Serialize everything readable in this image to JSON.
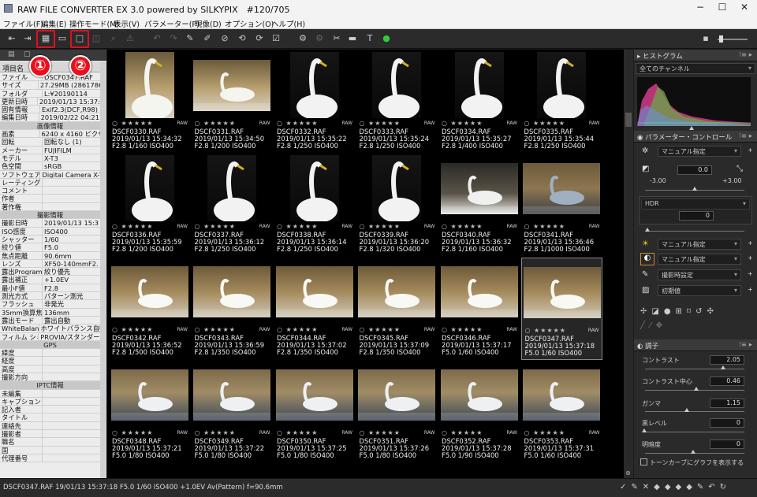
{
  "window": {
    "title": "RAW FILE CONVERTER EX 3.0 powered by SILKYPIX　#120/705"
  },
  "menu": [
    "ファイル(F)",
    "編集(E)",
    "操作モード(M)",
    "表示(V)",
    "パラメーター(P)",
    "現像(D)",
    "オプション(O)",
    "ヘルプ(H)"
  ],
  "markers": [
    "①",
    "②"
  ],
  "exif_header": "項目名",
  "exif_rows": [
    {
      "k": "ファイル",
      "v": "DSCF0347.RAF"
    },
    {
      "k": "サイズ",
      "v": "27.29MB (28617867"
    },
    {
      "k": "フォルダ",
      "v": "L:¥20190114"
    },
    {
      "k": "更新日時",
      "v": "2019/01/13 15:37:18"
    },
    {
      "k": "固有情報",
      "v": "Exif2.3(DCF,R98) Y"
    },
    {
      "k": "編集日時",
      "v": "2019/02/22 04:21:5"
    },
    {
      "section": "画像情報"
    },
    {
      "k": "画素",
      "v": "6240 x 4160 ピクセ"
    },
    {
      "k": "回転",
      "v": "回転なし (1)"
    },
    {
      "k": "メーカー",
      "v": "FUJIFILM"
    },
    {
      "k": "モデル",
      "v": "X-T3"
    },
    {
      "k": "色空間",
      "v": "sRGB"
    },
    {
      "k": "ソフトウェア",
      "v": "Digital Camera X-T"
    },
    {
      "k": "レーティング",
      "v": ""
    },
    {
      "k": "コメント",
      "v": ""
    },
    {
      "k": "作者",
      "v": ""
    },
    {
      "k": "著作権",
      "v": ""
    },
    {
      "section": "撮影情報"
    },
    {
      "k": "撮影日時",
      "v": "2019/01/13 15:3"
    },
    {
      "k": "ISO感度",
      "v": "ISO400"
    },
    {
      "k": "シャッター",
      "v": "1/60"
    },
    {
      "k": "絞り値",
      "v": "F5.0"
    },
    {
      "k": "焦点距離",
      "v": "90.6mm"
    },
    {
      "k": "レンズ",
      "v": "XF50-140mmF2."
    },
    {
      "k": "露出Program",
      "v": "絞り優先"
    },
    {
      "k": "露出補正",
      "v": "+1.0EV"
    },
    {
      "k": "最小F値",
      "v": "F2.8"
    },
    {
      "k": "測光方式",
      "v": "パターン測光"
    },
    {
      "k": "フラッシュ",
      "v": "非発光"
    },
    {
      "k": "35mm換算焦",
      "v": "136mm"
    },
    {
      "k": "露出モード",
      "v": "露出自動"
    },
    {
      "k": "WhiteBalance",
      "v": "ホワイトバランス自動"
    },
    {
      "k": "フィルム シミュレ",
      "v": "PROVIA/スタンダード"
    },
    {
      "section": "GPS"
    },
    {
      "k": "緯度",
      "v": ""
    },
    {
      "k": "経度",
      "v": ""
    },
    {
      "k": "高度",
      "v": ""
    },
    {
      "k": "撮影方向",
      "v": ""
    },
    {
      "section": "IPTC情報"
    },
    {
      "k": "未編集",
      "v": ""
    },
    {
      "k": "キャプション",
      "v": ""
    },
    {
      "k": "記入者",
      "v": ""
    },
    {
      "k": "タイトル",
      "v": ""
    },
    {
      "k": "連絡先",
      "v": ""
    },
    {
      "k": "撮影者",
      "v": ""
    },
    {
      "k": "職名",
      "v": ""
    },
    {
      "k": "国",
      "v": ""
    },
    {
      "k": "代理番号",
      "v": ""
    }
  ],
  "thumbs": [
    {
      "name": "DSCF0330.RAF",
      "date": "2019/01/13 15:34:32",
      "exp": "F2.8 1/160 ISO400",
      "orient": "p",
      "scene": "a"
    },
    {
      "name": "DSCF0331.RAF",
      "date": "2019/01/13 15:34:50",
      "exp": "F2.8 1/200 ISO400",
      "orient": "l",
      "scene": "a"
    },
    {
      "name": "DSCF0332.RAF",
      "date": "2019/01/13 15:35:22",
      "exp": "F2.8 1/250 ISO400",
      "orient": "p",
      "scene": "b"
    },
    {
      "name": "DSCF0333.RAF",
      "date": "2019/01/13 15:35:24",
      "exp": "F2.8 1/250 ISO400",
      "orient": "p",
      "scene": "b"
    },
    {
      "name": "DSCF0334.RAF",
      "date": "2019/01/13 15:35:27",
      "exp": "F2.8 1/400 ISO400",
      "orient": "p",
      "scene": "b"
    },
    {
      "name": "DSCF0335.RAF",
      "date": "2019/01/13 15:35:44",
      "exp": "F2.8 1/250 ISO400",
      "orient": "p",
      "scene": "b"
    },
    {
      "name": "DSCF0336.RAF",
      "date": "2019/01/13 15:35:59",
      "exp": "F2.8 1/200 ISO400",
      "orient": "p",
      "scene": "b"
    },
    {
      "name": "DSCF0337.RAF",
      "date": "2019/01/13 15:36:12",
      "exp": "F2.8 1/250 ISO400",
      "orient": "p",
      "scene": "b"
    },
    {
      "name": "DSCF0338.RAF",
      "date": "2019/01/13 15:36:14",
      "exp": "F2.8 1/250 ISO400",
      "orient": "p",
      "scene": "b"
    },
    {
      "name": "DSCF0339.RAF",
      "date": "2019/01/13 15:36:20",
      "exp": "F2.8 1/320 ISO400",
      "orient": "p",
      "scene": "b"
    },
    {
      "name": "DSCF0340.RAF",
      "date": "2019/01/13 15:36:32",
      "exp": "F2.8 1/160 ISO400",
      "orient": "l",
      "scene": "c"
    },
    {
      "name": "DSCF0341.RAF",
      "date": "2019/01/13 15:36:46",
      "exp": "F2.8 1/1000 ISO400",
      "orient": "l",
      "scene": "d"
    },
    {
      "name": "DSCF0342.RAF",
      "date": "2019/01/13 15:36:52",
      "exp": "F2.8 1/500 ISO400",
      "orient": "l",
      "scene": "e"
    },
    {
      "name": "DSCF0343.RAF",
      "date": "2019/01/13 15:36:59",
      "exp": "F2.8 1/350 ISO400",
      "orient": "l",
      "scene": "e"
    },
    {
      "name": "DSCF0344.RAF",
      "date": "2019/01/13 15:37:02",
      "exp": "F2.8 1/350 ISO400",
      "orient": "l",
      "scene": "e"
    },
    {
      "name": "DSCF0345.RAF",
      "date": "2019/01/13 15:37:09",
      "exp": "F2.8 1/350 ISO400",
      "orient": "l",
      "scene": "e"
    },
    {
      "name": "DSCF0346.RAF",
      "date": "2019/01/13 15:37:17",
      "exp": "F5.0 1/60 ISO400",
      "orient": "l",
      "scene": "e"
    },
    {
      "name": "DSCF0347.RAF",
      "date": "2019/01/13 15:37:18",
      "exp": "F5.0 1/60 ISO400",
      "orient": "l",
      "scene": "e",
      "selected": true
    },
    {
      "name": "DSCF0348.RAF",
      "date": "2019/01/13 15:37:21",
      "exp": "F5.0 1/80 ISO400",
      "orient": "l",
      "scene": "f"
    },
    {
      "name": "DSCF0349.RAF",
      "date": "2019/01/13 15:37:22",
      "exp": "F5.0 1/80 ISO400",
      "orient": "l",
      "scene": "f"
    },
    {
      "name": "DSCF0350.RAF",
      "date": "2019/01/13 15:37:25",
      "exp": "F5.0 1/80 ISO400",
      "orient": "l",
      "scene": "f"
    },
    {
      "name": "DSCF0351.RAF",
      "date": "2019/01/13 15:37:26",
      "exp": "F5.0 1/80 ISO400",
      "orient": "l",
      "scene": "f"
    },
    {
      "name": "DSCF0352.RAF",
      "date": "2019/01/13 15:37:28",
      "exp": "F5.0 1/90 ISO400",
      "orient": "l",
      "scene": "f"
    },
    {
      "name": "DSCF0353.RAF",
      "date": "2019/01/13 15:37:31",
      "exp": "F5.0 1/60 ISO400",
      "orient": "l",
      "scene": "f"
    }
  ],
  "stars": "○ ★★★★★",
  "raw_badge": "RAW",
  "histogram": {
    "title": "ヒストグラム",
    "channel": "全てのチャンネル"
  },
  "param": {
    "title": "パラメーター・コントロール",
    "preset": "マニュアル指定",
    "exposure_value": "0.0",
    "exposure_min": "-3.00",
    "exposure_max": "+3.00",
    "hdr_label": "HDR",
    "hdr_value": "0",
    "wb": "マニュアル指定",
    "tone": "マニュアル指定",
    "sharp": "撮影時設定",
    "nr": "初期値"
  },
  "tone": {
    "title": "調子",
    "contrast_label": "コントラスト",
    "contrast_value": "2.05",
    "center_label": "コントラスト中心",
    "center_value": "0.46",
    "gamma_label": "ガンマ",
    "gamma_value": "1.15",
    "black_label": "黒レベル",
    "black_value": "0",
    "bright_label": "明暗度",
    "bright_value": "0",
    "curve_label": "トーンカーブにグラフを表示する"
  },
  "status": {
    "text": "DSCF0347.RAF 19/01/13 15:37:18 F5.0 1/60 ISO400 +1.0EV Av(Pattern) f=90.6mm"
  }
}
